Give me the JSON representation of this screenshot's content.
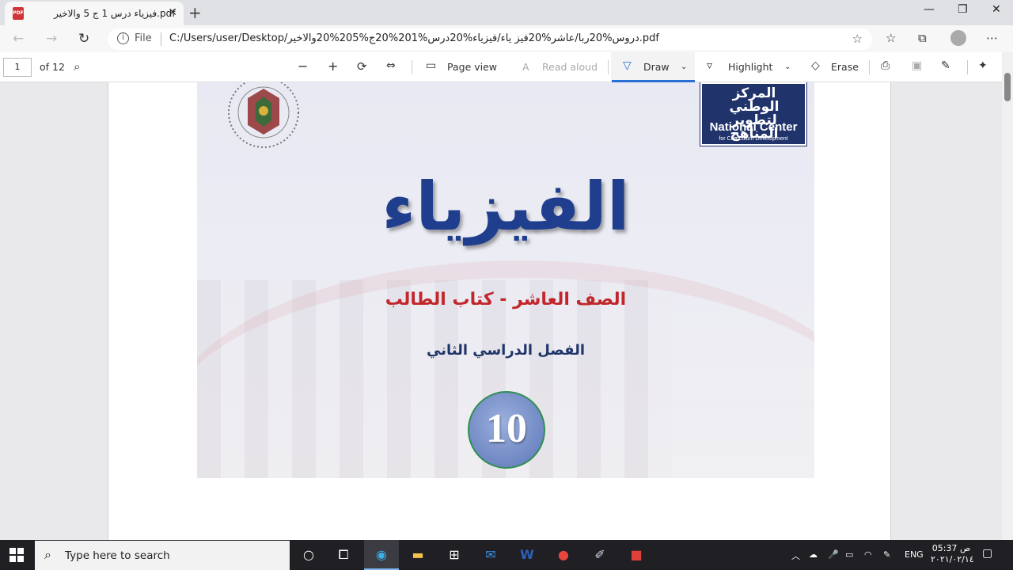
{
  "browser": {
    "tab_title": "فيزياء درس 1 ج 5 والاخير.pdf",
    "tab_icon": "pdf-icon",
    "address_prefix": "File",
    "url": "C:/Users/user/Desktop/دروس%20ربا/عاشر%20فيز ياء/فيزياء%20درس%201%20ج%205%20والاخير.pdf"
  },
  "pdf_toolbar": {
    "page_number": "1",
    "page_total": "of 12",
    "page_view": "Page view",
    "read_aloud": "Read aloud",
    "draw": "Draw",
    "highlight": "Highlight",
    "erase": "Erase"
  },
  "document": {
    "title": "الفيزياء",
    "subtitle": "الصف العاشر - كتاب الطالب",
    "semester": "الفصل الدراسي الثاني",
    "grade": "10",
    "nc_arabic": "المركز الوطني لتطوير المناهج",
    "nc_english": "National Center",
    "nc_english_sub": "for Curriculum Development"
  },
  "taskbar": {
    "search_placeholder": "Type here to search",
    "language": "ENG",
    "time": "05:37 ص",
    "date": "٢٠٢١/٠٢/١٤"
  }
}
